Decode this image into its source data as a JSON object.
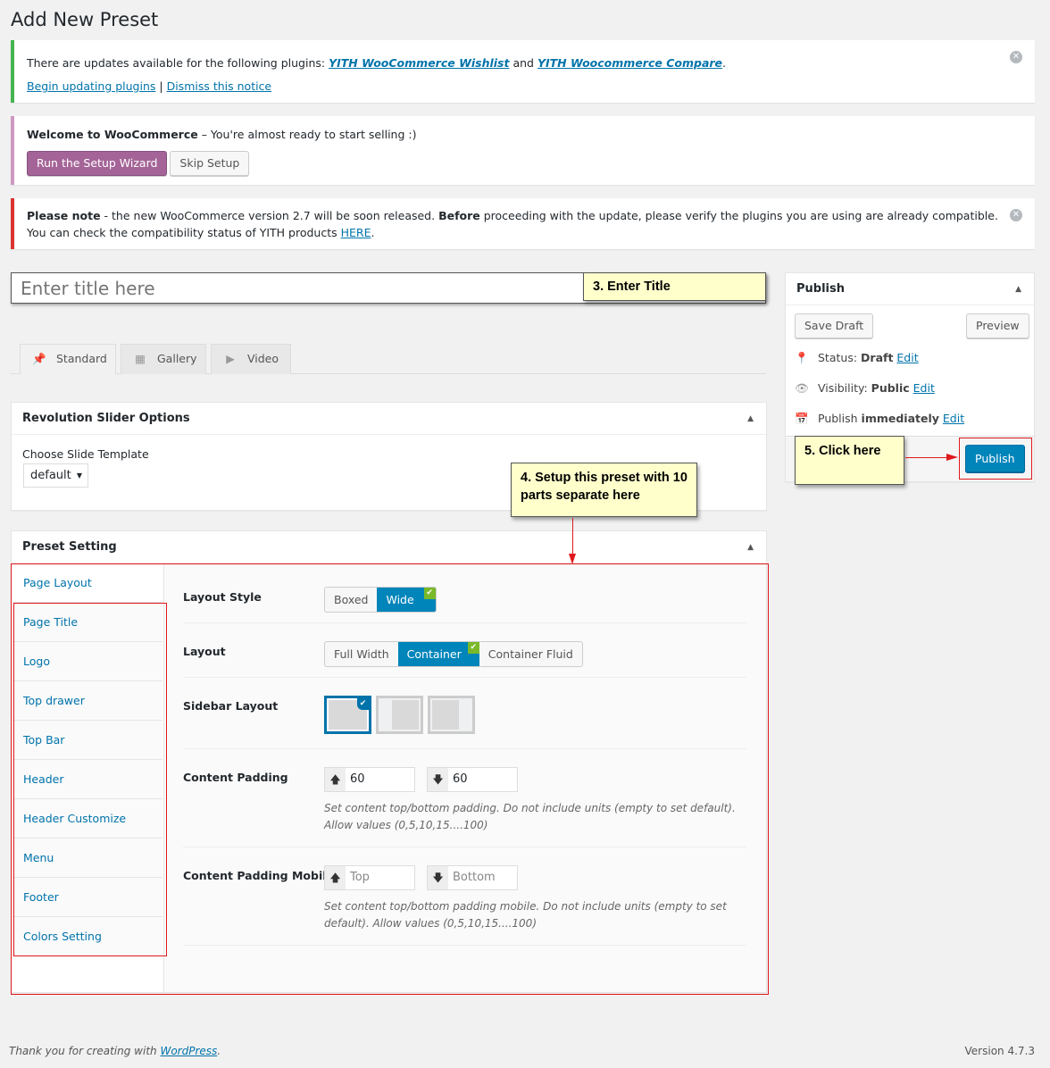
{
  "page_title": "Add New Preset",
  "notices": {
    "updates": {
      "text": "There are updates available for the following plugins: ",
      "plugin1": "YITH WooCommerce Wishlist",
      "and": " and ",
      "plugin2": "YITH Woocommerce Compare",
      "period": ".",
      "begin": "Begin updating plugins",
      "sep": " | ",
      "dismiss": "Dismiss this notice"
    },
    "woo": {
      "bold": "Welcome to WooCommerce",
      "text": " – You're almost ready to start selling :)",
      "run": "Run the Setup Wizard",
      "skip": "Skip Setup"
    },
    "note": {
      "bold1": "Please note",
      "text1": " - the new WooCommerce version 2.7 will be soon released. ",
      "bold2": "Before",
      "text2": " proceeding with the update, please verify the plugins you are using are already compatible. You can check the compatibility status of YITH products ",
      "here": "HERE",
      "period": "."
    }
  },
  "title_input": {
    "placeholder": "Enter title here"
  },
  "callouts": {
    "title": "3. Enter Title",
    "setup": "4. Setup this preset with 10 parts separate here",
    "publish": "5. Click here"
  },
  "format_tabs": [
    {
      "label": "Standard",
      "icon": "pin-icon"
    },
    {
      "label": "Gallery",
      "icon": "gallery-icon"
    },
    {
      "label": "Video",
      "icon": "video-icon"
    }
  ],
  "revslider": {
    "title": "Revolution Slider Options",
    "label": "Choose Slide Template",
    "select": "default"
  },
  "preset": {
    "title": "Preset Setting",
    "nav": [
      "Page Layout",
      "Page Title",
      "Logo",
      "Top drawer",
      "Top Bar",
      "Header",
      "Header Customize",
      "Menu",
      "Footer",
      "Colors Setting"
    ],
    "layout_style": {
      "label": "Layout Style",
      "options": [
        "Boxed",
        "Wide"
      ],
      "selected": "Wide"
    },
    "layout": {
      "label": "Layout",
      "options": [
        "Full Width",
        "Container",
        "Container Fluid"
      ],
      "selected": "Container"
    },
    "sidebar_layout": {
      "label": "Sidebar Layout",
      "selected": "none"
    },
    "content_padding": {
      "label": "Content Padding",
      "top": "60",
      "bottom": "60",
      "help": "Set content top/bottom padding. Do not include units (empty to set default). Allow values (0,5,10,15....100)"
    },
    "content_padding_mobile": {
      "label": "Content Padding Mobile",
      "top_placeholder": "Top",
      "bottom_placeholder": "Bottom",
      "help": "Set content top/bottom padding mobile. Do not include units (empty to set default). Allow values (0,5,10,15....100)"
    }
  },
  "publish": {
    "title": "Publish",
    "save_draft": "Save Draft",
    "preview": "Preview",
    "status_label": "Status: ",
    "status": "Draft",
    "visibility_label": "Visibility: ",
    "visibility": "Public",
    "schedule": "Publish ",
    "schedule_bold": "immediately",
    "edit": "Edit",
    "publish": "Publish"
  },
  "footer": {
    "thanks": "Thank you for creating with ",
    "wp": "WordPress",
    "period": ".",
    "version": "Version 4.7.3"
  },
  "colors": {
    "accent": "#0085ba",
    "woo": "#a46497",
    "success": "#46b450",
    "error": "#dc3232",
    "callout": "#ffffcc"
  }
}
